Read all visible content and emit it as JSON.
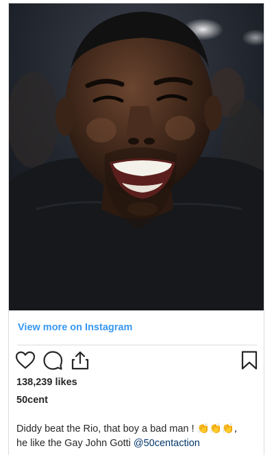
{
  "embed": {
    "view_more_label": "View more on Instagram",
    "likes_text": "138,239 likes",
    "username": "50cent",
    "caption": {
      "line1_text": "Diddy beat the Rio, that boy a bad man ! ",
      "line1_emoji": "👏👏👏,",
      "line2_text": "he like the Gay John Gotti ",
      "mention": "@50centaction"
    },
    "icons": {
      "like": "heart-icon",
      "comment": "comment-bubble-icon",
      "share": "share-icon",
      "save": "bookmark-icon"
    },
    "colors": {
      "link": "#3897f0",
      "text": "#262626",
      "mention": "#003569",
      "border": "#dbdbdb"
    }
  }
}
